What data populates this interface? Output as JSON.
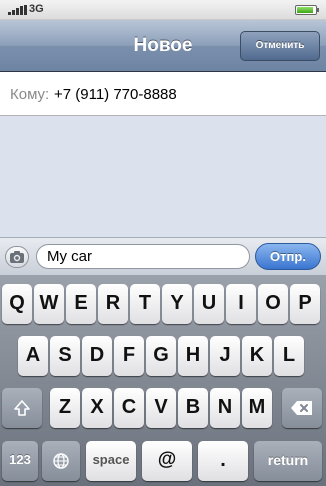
{
  "status_bar": {
    "carrier": "3G",
    "signal_icon": "signal-bars-icon",
    "battery_icon": "battery-icon",
    "battery_level": 0.9
  },
  "nav_bar": {
    "title": "Новое",
    "cancel_label": "Отменить"
  },
  "recipient": {
    "label": "Кому:",
    "value": "+7 (911) 770-8888"
  },
  "compose": {
    "camera_icon": "camera-icon",
    "message_value": "My car",
    "send_label": "Отпр."
  },
  "keyboard": {
    "row1": [
      "Q",
      "W",
      "E",
      "R",
      "T",
      "Y",
      "U",
      "I",
      "O",
      "P"
    ],
    "row2": [
      "A",
      "S",
      "D",
      "F",
      "G",
      "H",
      "J",
      "K",
      "L"
    ],
    "row3": [
      "Z",
      "X",
      "C",
      "V",
      "B",
      "N",
      "M"
    ],
    "numbers_label": "123",
    "space_label": "space",
    "at_label": "@",
    "dot_label": ".",
    "return_label": "return",
    "shift_icon": "shift-icon",
    "globe_icon": "globe-icon",
    "delete_icon": "backspace-icon"
  },
  "colors": {
    "nav_bar": "#6e84a3",
    "message_area": "#dbe2ed",
    "send_button": "#3a75d0",
    "keyboard": "#6a717c"
  }
}
